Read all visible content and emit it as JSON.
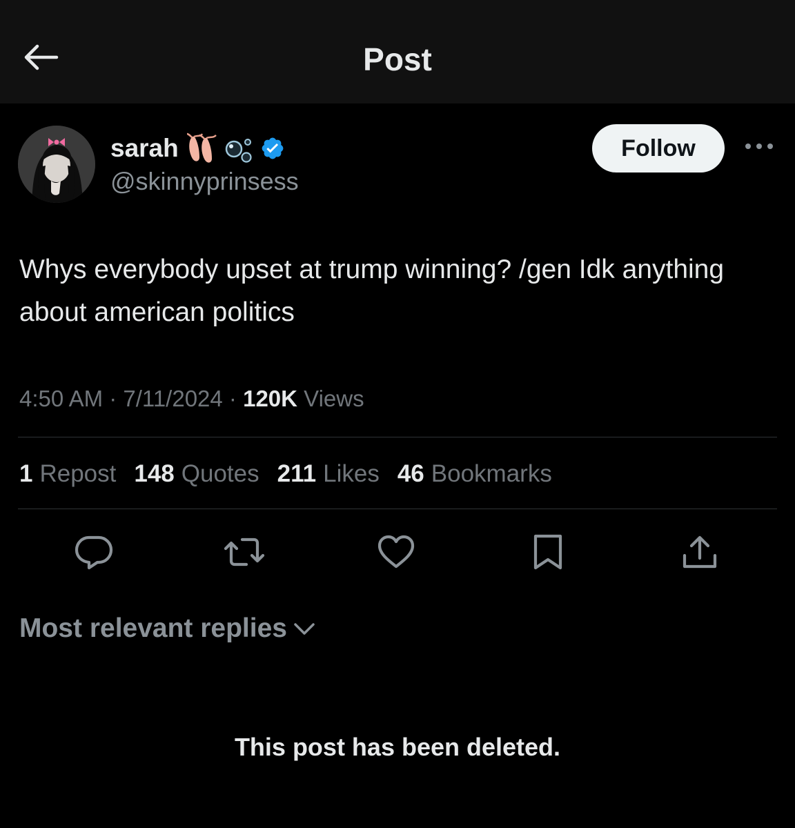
{
  "header": {
    "title": "Post",
    "back_icon": "arrow-left-icon"
  },
  "author": {
    "display_name": "sarah",
    "handle": "@skinnyprinsess",
    "name_emojis": [
      "ballet-shoes-emoji",
      "bubbles-emoji"
    ],
    "verified": true,
    "verified_color": "#1d9bf0"
  },
  "follow_button": {
    "label": "Follow"
  },
  "post": {
    "text": "Whys everybody upset at trump winning? /gen Idk anything about american politics",
    "time": "4:50 AM",
    "date": "7/11/2024",
    "views_count": "120K",
    "views_label": "Views"
  },
  "stats": [
    {
      "count": "1",
      "label": "Repost"
    },
    {
      "count": "148",
      "label": "Quotes"
    },
    {
      "count": "211",
      "label": "Likes"
    },
    {
      "count": "46",
      "label": "Bookmarks"
    }
  ],
  "actions": [
    "reply-icon",
    "repost-icon",
    "like-icon",
    "bookmark-icon",
    "share-icon"
  ],
  "replies": {
    "sort_label": "Most relevant replies",
    "deleted_notice": "This post has been deleted."
  },
  "colors": {
    "background": "#000000",
    "header_bg": "#111111",
    "text_primary": "#e7e9ea",
    "text_secondary": "#71767b",
    "divider": "#2f3336",
    "verified_blue": "#1d9bf0"
  }
}
